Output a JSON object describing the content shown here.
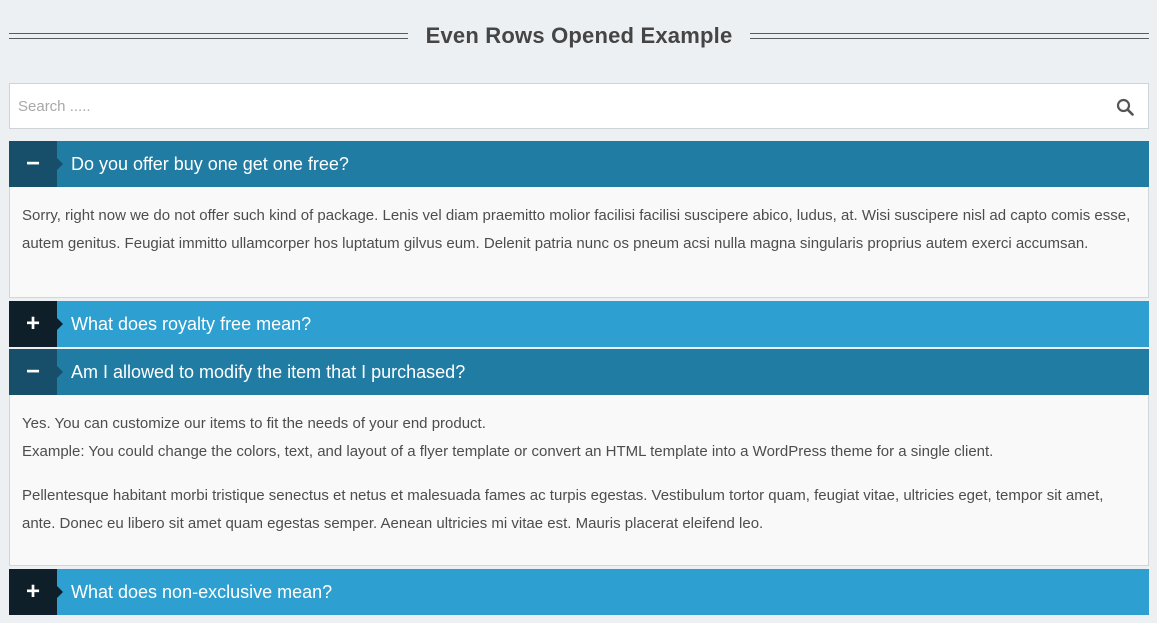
{
  "page": {
    "title": "Even Rows Opened Example"
  },
  "search": {
    "placeholder": "Search .....",
    "value": ""
  },
  "icons": {
    "search": "search-icon",
    "expand": "plus-icon",
    "collapse": "minus-icon"
  },
  "colors": {
    "open_header": "#217ca3",
    "closed_header": "#2e9fd1",
    "open_toggle": "#174f6b",
    "closed_toggle": "#0f1f2a"
  },
  "accordion": [
    {
      "question": "Do you offer buy one get one free?",
      "state": "open",
      "toggle_symbol": "−",
      "answer": [
        "Sorry, right now we do not offer such kind of package. Lenis vel diam praemitto molior facilisi facilisi suscipere abico, ludus, at. Wisi suscipere nisl ad capto comis esse, autem genitus. Feugiat immitto ullamcorper hos luptatum gilvus eum. Delenit patria nunc os pneum acsi nulla magna singularis proprius autem exerci accumsan."
      ]
    },
    {
      "question": "What does royalty free mean?",
      "state": "closed",
      "toggle_symbol": "+"
    },
    {
      "question": "Am I allowed to modify the item that I purchased?",
      "state": "open",
      "toggle_symbol": "−",
      "answer": [
        "Yes. You can customize our items to fit the needs of your end product.",
        "Example: You could change the colors, text, and layout of a flyer template or convert an HTML template into a WordPress theme for a single client.",
        "Pellentesque habitant morbi tristique senectus et netus et malesuada fames ac turpis egestas. Vestibulum tortor quam, feugiat vitae, ultricies eget, tempor sit amet, ante. Donec eu libero sit amet quam egestas semper. Aenean ultricies mi vitae est. Mauris placerat eleifend leo."
      ]
    },
    {
      "question": "What does non-exclusive mean?",
      "state": "closed",
      "toggle_symbol": "+"
    }
  ]
}
